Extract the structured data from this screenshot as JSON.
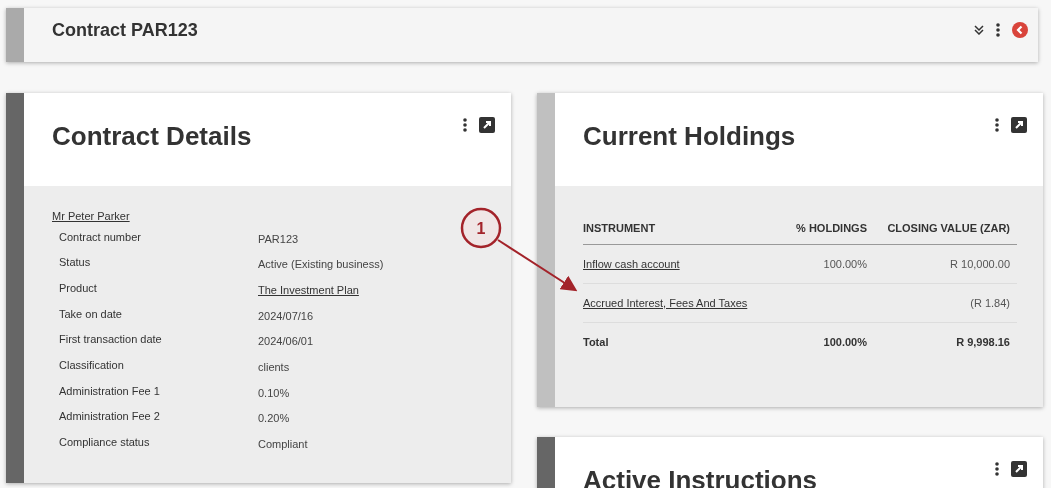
{
  "header": {
    "title": "Contract PAR123"
  },
  "contract_details": {
    "title": "Contract Details",
    "client_name": "Mr Peter Parker",
    "fields": [
      {
        "label": "Contract number",
        "value": "PAR123",
        "kind": "text"
      },
      {
        "label": "Status",
        "value": "Active (Existing business)",
        "kind": "text"
      },
      {
        "label": "Product",
        "value": "The Investment Plan",
        "kind": "link"
      },
      {
        "label": "Take on date",
        "value": "2024/07/16",
        "kind": "text"
      },
      {
        "label": "First transaction date",
        "value": "2024/06/01",
        "kind": "text"
      },
      {
        "label": "Classification",
        "value": "clients",
        "kind": "text"
      },
      {
        "label": "Administration Fee 1",
        "value": "0.10%",
        "kind": "text"
      },
      {
        "label": "Administration Fee 2",
        "value": "0.20%",
        "kind": "text"
      },
      {
        "label": "Compliance status",
        "value": "Compliant",
        "kind": "text"
      }
    ]
  },
  "current_holdings": {
    "title": "Current Holdings",
    "columns": [
      "INSTRUMENT",
      "% HOLDINGS",
      "CLOSING VALUE (ZAR)"
    ],
    "rows": [
      {
        "instrument": "Inflow cash account",
        "holdings": "100.00%",
        "closing_value": "R 10,000.00",
        "kind": "link"
      },
      {
        "instrument": "Accrued Interest, Fees And Taxes",
        "closing_value": "(R 1.84)",
        "kind": "link"
      },
      {
        "instrument": "Total",
        "holdings": "100.00%",
        "closing_value": "R 9,998.16",
        "kind": "total"
      }
    ]
  },
  "active_instructions": {
    "title": "Active Instructions"
  },
  "annotation": {
    "label": "1"
  }
}
